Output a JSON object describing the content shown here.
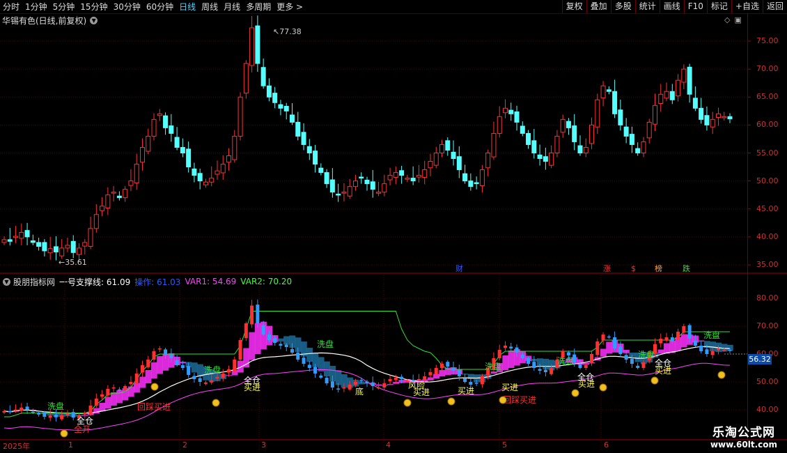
{
  "topbar": {
    "periods": [
      "分时",
      "1分钟",
      "5分钟",
      "15分钟",
      "30分钟",
      "60分钟",
      "日线",
      "周线",
      "月线",
      "多周期",
      "更多 >"
    ],
    "active_period": "日线",
    "tools": [
      "复权",
      "叠加",
      "多股",
      "统计",
      "画线",
      "F10",
      "标记",
      "+自选",
      "返回"
    ]
  },
  "main_chart": {
    "title": "华锡有色(日线,前复权)",
    "high_label": "77.38",
    "low_label": "35.61",
    "y_ticks": [
      "75.00",
      "70.00",
      "65.00",
      "60.00",
      "55.00",
      "50.00",
      "45.00",
      "40.00",
      "35.00"
    ],
    "event_markers": [
      "财",
      "涨",
      "$",
      "榜",
      "跌"
    ]
  },
  "indicator": {
    "name": "股朋指标网",
    "line1_label": "一号支撑线: 61.09",
    "op_label": "操作: 61.03",
    "var1_label": "VAR1: 54.69",
    "var2_label": "VAR2: 70.20",
    "y_ticks": [
      "80.00",
      "70.00",
      "60.00",
      "50.00",
      "40.00"
    ],
    "price_tag": "56.32",
    "annotations": [
      "洗盘",
      "洗盘",
      "洗盘",
      "洗盘",
      "洗盘",
      "洗盘",
      "洗盘",
      "全仓",
      "全仓",
      "全仓",
      "全仓",
      "买进",
      "买进",
      "买进",
      "买进",
      "买进",
      "买进",
      "回踩买进",
      "回踩买进",
      "风险",
      "底",
      "全开"
    ]
  },
  "x_axis": {
    "labels": [
      "2025年",
      "1",
      "2",
      "3",
      "4",
      "5",
      "6"
    ]
  },
  "watermark": {
    "line1": "乐淘公式网",
    "line2": "www.60lt.com"
  },
  "colors": {
    "up": "#ff3030",
    "down": "#54ffff",
    "grid": "#5a0000",
    "axis": "#a00000"
  },
  "chart_data": {
    "type": "candlestick",
    "y_range": [
      33,
      79
    ],
    "closes": [
      39.5,
      39.2,
      40.1,
      40.8,
      40.0,
      39.0,
      38.3,
      37.5,
      37.9,
      37.3,
      38.0,
      38.5,
      37.2,
      38.0,
      39.0,
      41.5,
      44.0,
      45.5,
      47.5,
      48.0,
      47.0,
      48.5,
      50.0,
      53.0,
      56.0,
      58.0,
      61.0,
      62.0,
      59.5,
      58.5,
      56.0,
      55.0,
      52.5,
      51.0,
      50.0,
      49.8,
      50.5,
      51.8,
      53.0,
      54.5,
      58.0,
      65.0,
      71.0,
      77.38,
      71.0,
      67.0,
      65.0,
      64.0,
      63.0,
      62.5,
      60.5,
      58.0,
      56.5,
      55.0,
      53.0,
      51.5,
      49.5,
      48.0,
      47.5,
      48.0,
      49.0,
      50.0,
      50.5,
      49.5,
      48.5,
      48.0,
      49.5,
      51.0,
      51.5,
      51.0,
      50.5,
      50.0,
      51.0,
      52.0,
      53.5,
      55.0,
      56.5,
      55.5,
      54.0,
      52.0,
      50.0,
      49.0,
      49.5,
      52.0,
      55.0,
      58.5,
      61.5,
      63.0,
      62.0,
      60.5,
      58.5,
      56.5,
      55.0,
      54.0,
      53.5,
      55.0,
      58.0,
      61.0,
      59.5,
      57.0,
      55.0,
      56.0,
      60.0,
      64.5,
      67.0,
      66.0,
      62.0,
      60.0,
      58.0,
      56.5,
      55.0,
      57.0,
      60.5,
      63.5,
      65.5,
      66.0,
      64.5,
      68.0,
      70.0,
      65.5,
      63.0,
      61.0,
      60.0,
      61.0,
      62.0,
      61.5,
      61.1
    ]
  }
}
